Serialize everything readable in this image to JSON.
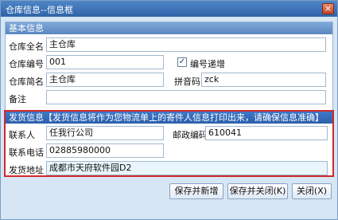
{
  "window": {
    "title": "仓库信息--信息框",
    "close_icon": "×"
  },
  "basic": {
    "heading": "基本信息",
    "name_label": "仓库全名",
    "name_value": "主仓库",
    "code_label": "仓库编号",
    "code_value": "001",
    "auto_increment_label": "编号递增",
    "auto_increment_checked": true,
    "short_name_label": "仓库简名",
    "short_name_value": "主仓库",
    "pinyin_label": "拼音码",
    "pinyin_value": "zck",
    "note_label": "备注",
    "note_value": ""
  },
  "shipping": {
    "heading": "发货信息【发货信息将作为您物流单上的寄件人信息打印出来，请确保信息准确】",
    "contact_label": "联系人",
    "contact_value": "任我行公司",
    "postcode_label": "邮政编码",
    "postcode_value": "610041",
    "phone_label": "联系电话",
    "phone_value": "02885980000",
    "address_label": "发货地址",
    "address_value": "成都市天府软件园D2"
  },
  "buttons": {
    "save_new": "保存并新增",
    "save_close": "保存并关闭(K)",
    "close": "关闭(X)"
  },
  "colors": {
    "title_bar": "#3a70b5",
    "highlight_border": "#d12a2a",
    "body_bg": "#d6e6f5"
  }
}
